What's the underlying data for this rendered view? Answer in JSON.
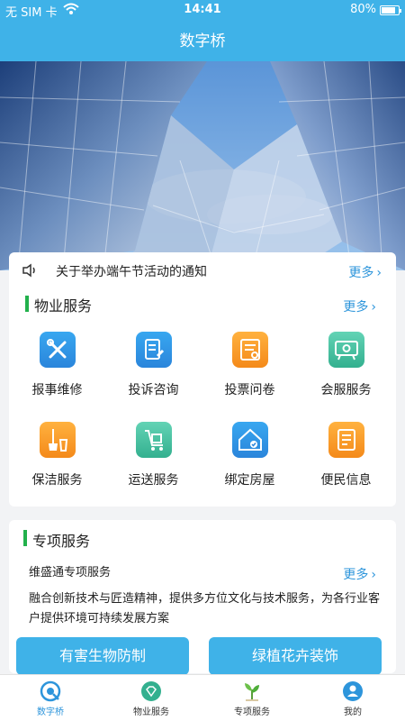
{
  "status_bar": {
    "carrier": "无 SIM 卡",
    "time": "14:41",
    "battery": "80%"
  },
  "nav": {
    "title": "数字桥"
  },
  "notice": {
    "text": "关于举办端午节活动的通知",
    "more": "更多"
  },
  "property": {
    "title": "物业服务",
    "more": "更多",
    "items": [
      {
        "label": "报事维修",
        "icon": "tools-icon"
      },
      {
        "label": "投诉咨询",
        "icon": "edit-document-icon"
      },
      {
        "label": "投票问卷",
        "icon": "checklist-icon"
      },
      {
        "label": "会服服务",
        "icon": "meeting-board-icon"
      },
      {
        "label": "保洁服务",
        "icon": "cleaning-icon"
      },
      {
        "label": "运送服务",
        "icon": "trolley-icon"
      },
      {
        "label": "绑定房屋",
        "icon": "house-check-icon"
      },
      {
        "label": "便民信息",
        "icon": "info-note-icon"
      }
    ]
  },
  "special": {
    "title": "专项服务",
    "sub_title": "维盛通专项服务",
    "more": "更多",
    "description": "融合创新技术与匠造精神，提供多方位文化与技术服务，为各行业客户提供环境可持续发展方案",
    "buttons": [
      "有害生物防制",
      "绿植花卉装饰"
    ]
  },
  "tabbar": {
    "items": [
      {
        "label": "数字桥",
        "icon": "home-logo-icon",
        "active": true
      },
      {
        "label": "物业服务",
        "icon": "diamond-icon",
        "active": false
      },
      {
        "label": "专项服务",
        "icon": "plant-icon",
        "active": false
      },
      {
        "label": "我的",
        "icon": "user-icon",
        "active": false
      }
    ]
  },
  "colors": {
    "primary": "#3fb2e8",
    "link": "#2d95db",
    "section_bar": "#22b14c",
    "orange": "#f48a1a",
    "teal": "#33b08f"
  }
}
